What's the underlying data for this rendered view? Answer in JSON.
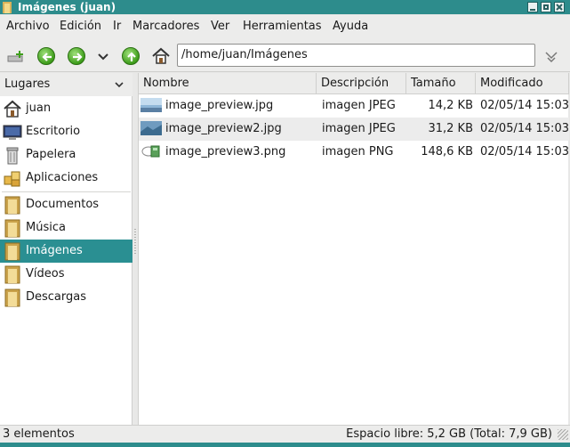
{
  "window": {
    "title": "Imágenes (juan)"
  },
  "menu": [
    "Archivo",
    "Edición",
    "Ir",
    "Marcadores",
    "Ver",
    "Herramientas",
    "Ayuda"
  ],
  "toolbar": {
    "location": "/home/juan/Imágenes",
    "icons": [
      "new-tab-icon",
      "back-icon",
      "forward-icon",
      "history-dropdown-icon",
      "up-icon",
      "home-icon",
      "location-go-icon"
    ]
  },
  "sidebar": {
    "header": "Lugares",
    "places": [
      {
        "label": "juan",
        "icon": "home-icon"
      },
      {
        "label": "Escritorio",
        "icon": "desktop-icon"
      },
      {
        "label": "Papelera",
        "icon": "trash-icon"
      },
      {
        "label": "Aplicaciones",
        "icon": "applications-icon"
      }
    ],
    "bookmarks": [
      {
        "label": "Documentos",
        "icon": "folder-icon"
      },
      {
        "label": "Música",
        "icon": "folder-icon"
      },
      {
        "label": "Imágenes",
        "icon": "folder-icon",
        "selected": true
      },
      {
        "label": "Vídeos",
        "icon": "folder-icon"
      },
      {
        "label": "Descargas",
        "icon": "folder-icon"
      }
    ]
  },
  "filelist": {
    "columns": [
      "Nombre",
      "Descripción",
      "Tamaño",
      "Modificado"
    ],
    "rows": [
      {
        "name": "image_preview.jpg",
        "desc": "imagen JPEG",
        "size": "14,2 KB",
        "modified": "02/05/14 15:03"
      },
      {
        "name": "image_preview2.jpg",
        "desc": "imagen JPEG",
        "size": "31,2 KB",
        "modified": "02/05/14 15:03"
      },
      {
        "name": "image_preview3.png",
        "desc": "imagen PNG",
        "size": "148,6 KB",
        "modified": "02/05/14 15:03"
      }
    ]
  },
  "status": {
    "count": "3 elementos",
    "free": "Espacio libre: 5,2 GB (Total: 7,9 GB)"
  },
  "colors": {
    "titlebar": "#2d8c8c",
    "selection": "#2a8f92"
  }
}
